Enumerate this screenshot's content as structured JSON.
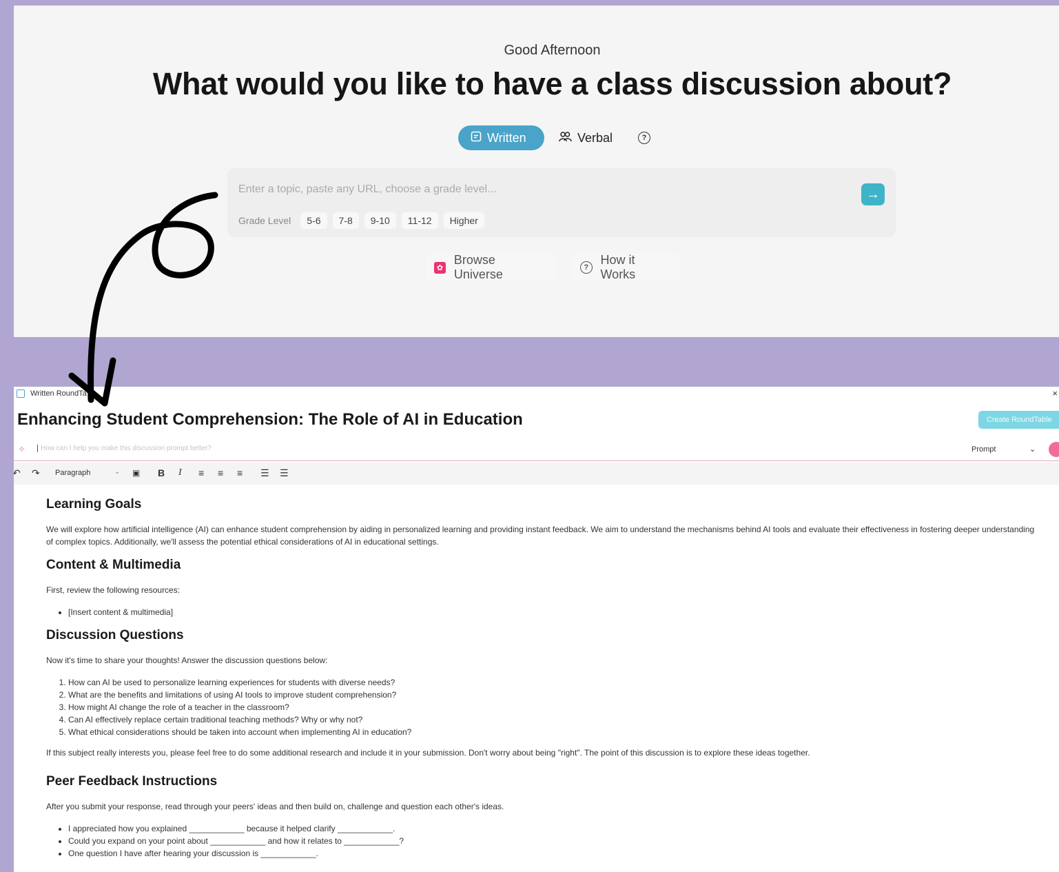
{
  "top": {
    "greeting": "Good Afternoon",
    "headline": "What would you like to have a class discussion about?",
    "mode_written": "Written",
    "mode_verbal": "Verbal",
    "prompt_placeholder": "Enter a topic, paste any URL, choose a grade level...",
    "grade_label": "Grade Level",
    "grades": [
      "5-6",
      "7-8",
      "9-10",
      "11-12",
      "Higher"
    ],
    "browse_label": "Browse Universe",
    "how_label": "How it Works"
  },
  "doc": {
    "tab_label": "Written RoundTa",
    "title": "Enhancing Student Comprehension: The Role of AI in Education",
    "create_button": "Create RoundTable",
    "ai_placeholder": "How can I help you make this discussion prompt better?",
    "prompt_select": "Prompt",
    "toolbar_style": "Paragraph",
    "sections": {
      "learning_goals_heading": "Learning Goals",
      "learning_goals_text": "We will explore how artificial intelligence (AI) can enhance student comprehension by aiding in personalized learning and providing instant feedback. We aim to understand the mechanisms behind AI tools and evaluate their effectiveness in fostering deeper understanding of complex topics. Additionally, we'll assess the potential ethical considerations of AI in educational settings.",
      "content_heading": "Content & Multimedia",
      "content_intro": "First, review the following resources:",
      "content_bullet": "[Insert content & multimedia]",
      "questions_heading": "Discussion Questions",
      "questions_intro": "Now it's time to share your thoughts! Answer the discussion questions below:",
      "questions": [
        "How can AI be used to personalize learning experiences for students with diverse needs?",
        "What are the benefits and limitations of using AI tools to improve student comprehension?",
        "How might AI change the role of a teacher in the classroom?",
        "Can AI effectively replace certain traditional teaching methods? Why or why not?",
        "What ethical considerations should be taken into account when implementing AI in education?"
      ],
      "questions_outro": "If this subject really interests you, please feel free to do some additional research and include it in your submission. Don't worry about being \"right\". The point of this discussion is to explore these ideas together.",
      "peer_heading": "Peer Feedback Instructions",
      "peer_intro": "After you submit your response, read through your peers' ideas and then build on, challenge and question each other's ideas.",
      "peer_bullets": [
        "I appreciated how you explained ____________ because it helped clarify ____________.",
        "Could you expand on your point about ____________ and how it relates to ____________?",
        "One question I have after hearing your discussion is ____________."
      ]
    }
  },
  "colors": {
    "background": "#b0a6d1",
    "accent_blue": "#4aa3c9",
    "send_teal": "#3fb4c9",
    "pink": "#e9356f"
  }
}
